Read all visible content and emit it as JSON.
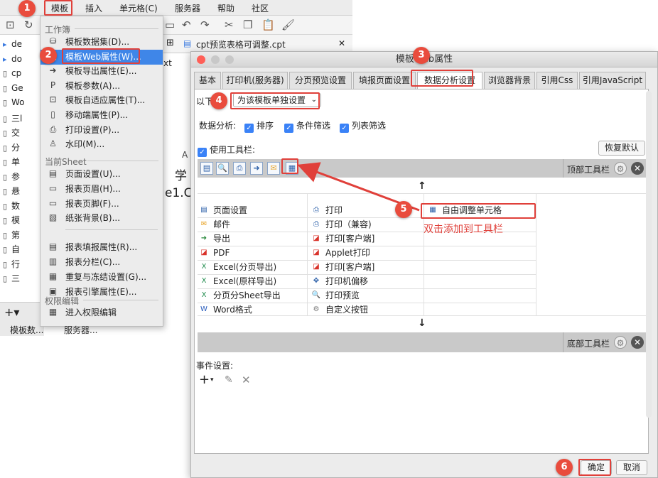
{
  "menubar": {
    "items": [
      "模板",
      "插入",
      "单元格(C)",
      "服务器",
      "帮助",
      "社区"
    ]
  },
  "tree": {
    "items": [
      "de",
      "do",
      "cp",
      "Ge",
      "Wo",
      "三l",
      "交",
      "分",
      "单",
      "参",
      "悬",
      "数",
      "模",
      "第",
      "自",
      "行",
      "三"
    ],
    "bottom_label": "模板数..."
  },
  "file_tab": {
    "title": "cpt预览表格可调整.cpt",
    "partial_label": "xt"
  },
  "grid_snippets": {
    "letter": "A",
    "char1": "学",
    "value": "e1.C"
  },
  "dropdown": {
    "section_workbook": "工作簿",
    "workbook_items": [
      {
        "label": "模板数据集(D)...",
        "icon": "database-icon"
      },
      {
        "label": "模板Web属性(W)...",
        "icon": "web-icon"
      },
      {
        "label": "模板导出属性(E)...",
        "icon": "export-icon"
      },
      {
        "label": "模板参数(A)...",
        "icon": "parameter-icon"
      },
      {
        "label": "模板自适应属性(T)...",
        "icon": "adaptive-icon"
      },
      {
        "label": "移动端属性(P)...",
        "icon": "mobile-icon"
      },
      {
        "label": "打印设置(P)...",
        "icon": "printer-icon"
      },
      {
        "label": "水印(M)...",
        "icon": "watermark-icon"
      }
    ],
    "section_sheet": "当前Sheet",
    "sheet_items": [
      {
        "label": "页面设置(U)...",
        "icon": "page-setup-icon"
      },
      {
        "label": "报表页眉(H)...",
        "icon": "header-icon"
      },
      {
        "label": "报表页脚(F)...",
        "icon": "footer-icon"
      },
      {
        "label": "纸张背景(B)...",
        "icon": "paper-background-icon"
      },
      {
        "label": "报表填报属性(R)...",
        "icon": "fill-report-icon"
      },
      {
        "label": "报表分栏(C)...",
        "icon": "columns-icon"
      },
      {
        "label": "重复与冻结设置(G)...",
        "icon": "freeze-icon"
      },
      {
        "label": "报表引擎属性(E)...",
        "icon": "engine-icon"
      }
    ],
    "section_permission": "权限编辑",
    "permission_item": {
      "label": "进入权限编辑",
      "icon": "permission-icon"
    },
    "bottom_label": "服务器..."
  },
  "dialog": {
    "title": "模板Web属性",
    "tabs": [
      "基本",
      "打印机(服务器)",
      "分页预览设置",
      "填报页面设置",
      "数据分析设置",
      "浏览器背景",
      "引用Css",
      "引用JavaScript"
    ],
    "selected_tab": 4,
    "scope_label": "以下",
    "scope_value": "为该模板单独设置",
    "analysis_label": "数据分析:",
    "checks": [
      "排序",
      "条件筛选",
      "列表筛选"
    ],
    "use_toolbar_label": "使用工具栏:",
    "restore_default": "恢复默认",
    "top_toolbar_label": "顶部工具栏",
    "bottom_toolbar_label": "底部工具栏",
    "up_arrow": "↑",
    "down_arrow": "↓",
    "column1": [
      {
        "label": "页面设置",
        "icon": "page-setup-icon"
      },
      {
        "label": "邮件",
        "icon": "mail-icon"
      },
      {
        "label": "导出",
        "icon": "export-icon"
      },
      {
        "label": "PDF",
        "icon": "pdf-icon"
      },
      {
        "label": "Excel(分页导出)",
        "icon": "excel-icon"
      },
      {
        "label": "Excel(原样导出)",
        "icon": "excel-icon"
      },
      {
        "label": "分页分Sheet导出",
        "icon": "excel-icon"
      },
      {
        "label": "Word格式",
        "icon": "word-icon"
      }
    ],
    "column2": [
      {
        "label": "打印",
        "icon": "printer-icon"
      },
      {
        "label": "打印（兼容)",
        "icon": "printer-icon"
      },
      {
        "label": "打印[客户端]",
        "icon": "print-client-icon"
      },
      {
        "label": "Applet打印",
        "icon": "pdf-icon"
      },
      {
        "label": "打印[客户端]",
        "icon": "pdf-icon"
      },
      {
        "label": "打印机偏移",
        "icon": "move-icon"
      },
      {
        "label": "打印预览",
        "icon": "preview-icon"
      },
      {
        "label": "自定义按钮",
        "icon": "gear-icon"
      }
    ],
    "column3": [
      {
        "label": "自由调整单元格",
        "icon": "grid-icon"
      }
    ],
    "event_label": "事件设置:",
    "ok": "确定",
    "cancel": "取消"
  },
  "annotation": "双击添加到工具栏",
  "callouts": [
    "1",
    "2",
    "3",
    "4",
    "5",
    "6"
  ],
  "colors": {
    "accent_red": "#e0403a",
    "selection_blue": "#3f86e8"
  }
}
